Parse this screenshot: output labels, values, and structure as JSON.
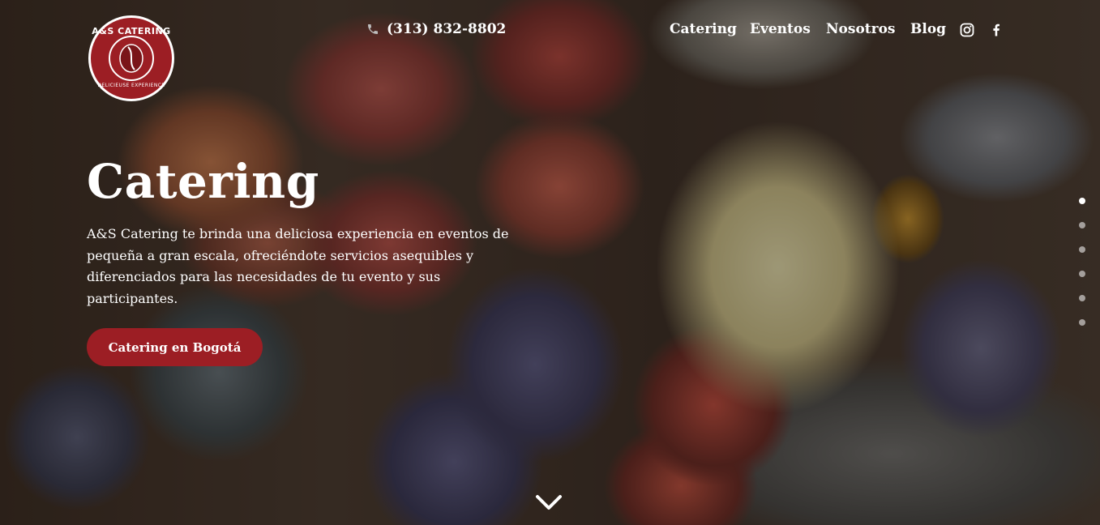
{
  "header": {
    "logo": {
      "top_text": "A&S CATERING",
      "bottom_text": "DELICIEUSE EXPERIENCE"
    },
    "phone": {
      "number": "(313) 832-8802",
      "icon": "phone-icon"
    },
    "nav": [
      {
        "label": "Catering"
      },
      {
        "label": "Eventos"
      },
      {
        "label": "Nosotros"
      },
      {
        "label": "Blog"
      }
    ],
    "social": [
      {
        "icon": "instagram-icon"
      },
      {
        "icon": "facebook-icon"
      }
    ]
  },
  "hero": {
    "title": "Catering",
    "description": "A&S Catering te brinda una deliciosa experiencia en eventos de pequeña a gran escala, ofreciéndote servicios asequibles y diferenciados para las necesidades de tu evento y sus participantes.",
    "cta_label": "Catering en Bogotá"
  },
  "slider": {
    "count": 6,
    "active_index": 0
  },
  "scroll_icon": "chevron-down-icon",
  "colors": {
    "brand": "#9c1e24",
    "text": "#ffffff"
  }
}
